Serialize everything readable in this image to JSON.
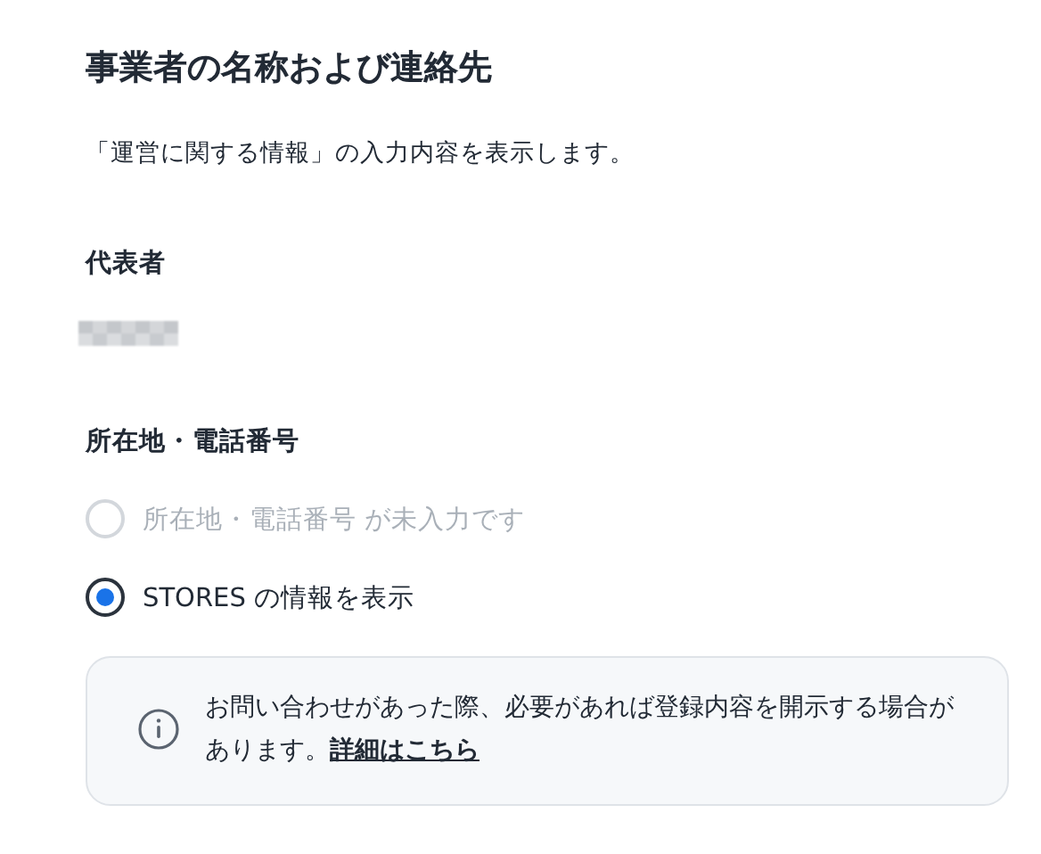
{
  "title": "事業者の名称および連絡先",
  "description": "「運営に関する情報」の入力内容を表示します。",
  "representative": {
    "label": "代表者",
    "value_redacted": true
  },
  "address": {
    "label": "所在地・電話番号",
    "options": [
      {
        "label": "所在地・電話番号 が未入力です",
        "selected": false,
        "disabled": true
      },
      {
        "label": "STORES の情報を表示",
        "selected": true,
        "disabled": false
      }
    ]
  },
  "notice": {
    "text": "お問い合わせがあった際、必要があれば登録内容を開示する場合があります。",
    "link": "詳細はこちら"
  }
}
